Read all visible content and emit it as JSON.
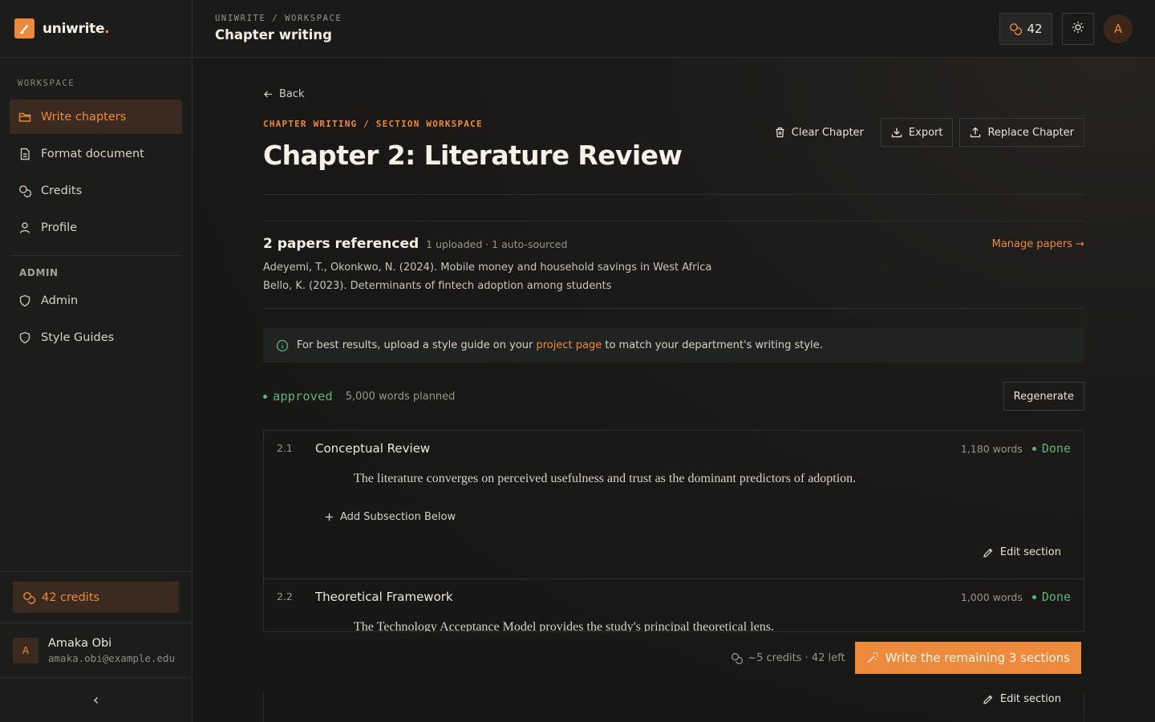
{
  "brand": {
    "name": "uniwrite",
    "dot": "."
  },
  "sidebar": {
    "section_label": "WORKSPACE",
    "items": [
      {
        "label": "Write chapters",
        "icon": "folder-icon",
        "active": true
      },
      {
        "label": "Format document",
        "icon": "document-icon"
      },
      {
        "label": "Credits",
        "icon": "coins-icon"
      },
      {
        "label": "Profile",
        "icon": "user-icon"
      }
    ],
    "admin_label": "ADMIN",
    "admin_items": [
      {
        "label": "Admin",
        "icon": "shield-icon"
      },
      {
        "label": "Style Guides",
        "icon": "shield-icon"
      }
    ],
    "credits": "42 credits",
    "user": {
      "initial": "A",
      "name": "Amaka Obi",
      "email": "amaka.obi@example.edu"
    }
  },
  "header": {
    "breadcrumb": "UNIWRITE / WORKSPACE",
    "title": "Chapter writing",
    "credit_count": "42",
    "avatar_initial": "A"
  },
  "page": {
    "back_label": "Back",
    "eyebrow": "CHAPTER WRITING / SECTION WORKSPACE",
    "title": "Chapter 2: Literature Review",
    "actions": {
      "clear": "Clear Chapter",
      "export": "Export",
      "replace": "Replace Chapter"
    },
    "papers": {
      "title": "2 papers referenced",
      "subtitle": "1 uploaded · 1 auto-sourced",
      "manage": "Manage papers →",
      "refs": [
        "Adeyemi, T., Okonkwo, N. (2024). Mobile money and household savings in West Africa",
        "Bello, K. (2023). Determinants of fintech adoption among students"
      ]
    },
    "info": {
      "pre": "For best results, upload a style guide on your ",
      "link": "project page",
      "post": " to match your department's writing style."
    },
    "status": "approved",
    "words_planned": "5,000 words planned",
    "regenerate": "Regenerate",
    "sections": [
      {
        "num": "2.1",
        "title": "Conceptual Review",
        "words": "1,180 words",
        "status": "Done",
        "body": "The literature converges on perceived usefulness and trust as the dominant predictors of adoption.",
        "add_sub": "Add Subsection Below",
        "edit": "Edit section"
      },
      {
        "num": "2.2",
        "title": "Theoretical Framework",
        "words": "1,000 words",
        "status": "Done",
        "body": "The Technology Acceptance Model provides the study's principal theoretical lens.",
        "edit": "Edit section"
      }
    ],
    "cta": {
      "cost": "~5 credits · 42 left",
      "label": "Write the remaining 3 sections"
    }
  },
  "colors": {
    "accent": "#ee8a3c",
    "success": "#5fb27a",
    "background": "#171716"
  }
}
